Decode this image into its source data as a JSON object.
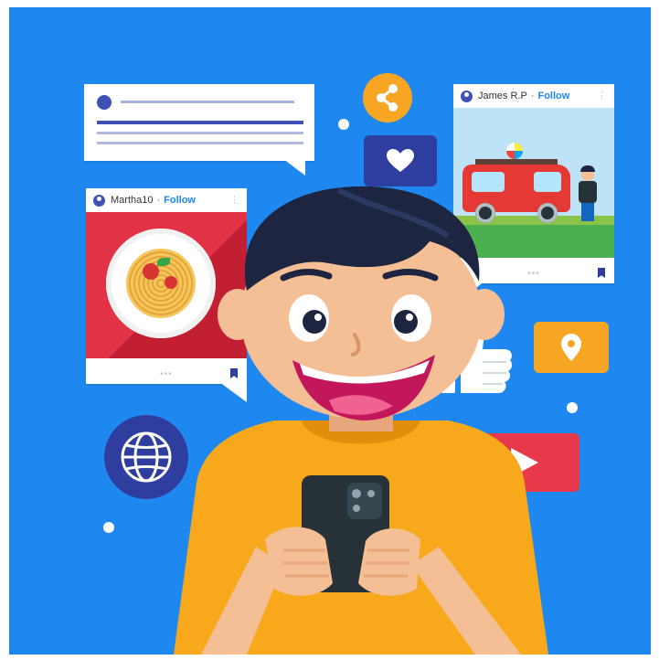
{
  "posts": [
    {
      "username": "Martha10",
      "separator": "·",
      "follow_label": "Follow",
      "image": "spaghetti-plate"
    },
    {
      "username": "James R.P",
      "separator": "·",
      "follow_label": "Follow",
      "image": "camper-van-travel"
    }
  ],
  "icons": [
    "share-icon",
    "heart-icon",
    "thumbs-up-icon",
    "location-pin-icon",
    "globe-icon",
    "play-icon"
  ],
  "colors": {
    "background": "#1e88f0",
    "shirt": "#f7a81b",
    "skin": "#f4bf95",
    "hair": "#1d2540",
    "accent_red": "#e8394a",
    "accent_orange": "#f6a623",
    "accent_navy": "#2f3e9e"
  }
}
